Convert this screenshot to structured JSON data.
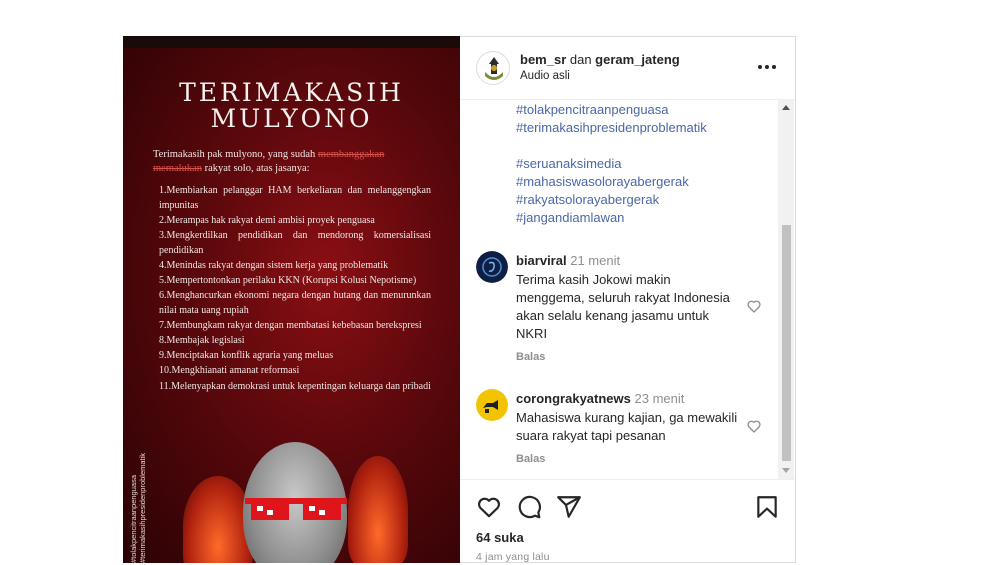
{
  "post": {
    "poster": {
      "title_line1": "TERIMAKASIH",
      "title_line2": "MULYONO",
      "intro_a": "Terimakasih pak mulyono, yang sudah ",
      "intro_strike1": "membanggakan",
      "intro_strike2": "memalukan",
      "intro_b": " rakyat solo, atas jasanya:",
      "points": [
        "1.Membiarkan pelanggar HAM berkeliaran dan melanggengkan impunitas",
        "2.Merampas hak rakyat demi ambisi proyek penguasa",
        "3.Mengkerdilkan pendidikan dan mendorong komersialisasi pendidikan",
        "4.Menindas rakyat dengan sistem kerja yang problematik",
        "5.Mempertontonkan perilaku KKN (Korupsi Kolusi Nepotisme)",
        "6.Menghancurkan ekonomi negara dengan hutang dan menurunkan nilai mata uang rupiah",
        "7.Membungkam rakyat dengan membatasi kebebasan berekspresi",
        "8.Membajak legislasi",
        "9.Menciptakan konflik agraria yang meluas",
        "10.Mengkhianati amanat reformasi",
        "11.Melenyapkan demokrasi untuk kepentingan keluarga dan pribadi"
      ],
      "vertical_tag1": "#tolakpencitraanpenguasa",
      "vertical_tag2": "#terimakasihpresidenproblematik"
    }
  },
  "header": {
    "user1": "bem_sr",
    "connector": " dan ",
    "user2": "geram_jateng",
    "audio": "Audio asli"
  },
  "caption_tags": [
    "#tolakpencitraanpenguasa",
    "#terimakasihpresidenproblematik",
    "#seruanaksimedia",
    "#mahasiswasolorayabergerak",
    "#rakyatsolorayabergerak",
    "#jangandiamlawan"
  ],
  "comments": [
    {
      "user": "biarviral",
      "time": "21 menit",
      "text": "Terima kasih Jokowi makin menggema, seluruh rakyat Indonesia akan selalu kenang jasamu untuk NKRI",
      "reply": "Balas"
    },
    {
      "user": "corongrakyatnews",
      "time": "23 menit",
      "text": "Mahasiswa kurang kajian, ga mewakili suara rakyat tapi pesanan",
      "reply": "Balas"
    }
  ],
  "stats": {
    "likes": "64 suka",
    "time": "4 jam yang lalu"
  },
  "colors": {
    "hashtag": "#4a67a8",
    "text": "#262626",
    "muted": "#8e8e8e",
    "poster_red": "#8a0f14"
  }
}
